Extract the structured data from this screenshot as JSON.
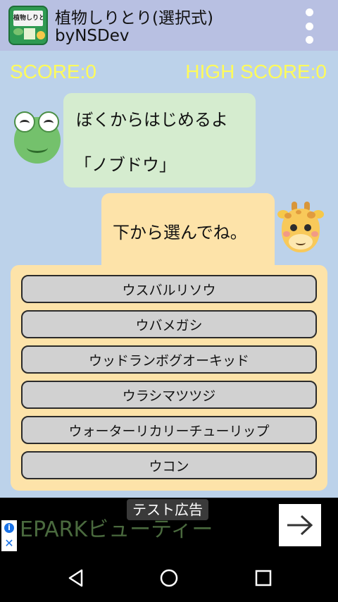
{
  "app_bar": {
    "title": "植物しりとり(選択式)",
    "subtitle": "byNSDev",
    "icon_sign_text": "植物しりとり",
    "icons": {
      "app_icon": "app-icon",
      "menu": "more-vert-icon"
    }
  },
  "scores": {
    "score": "SCORE:0",
    "high_score": "HIGH SCORE:0",
    "color": "#fffb5a"
  },
  "frog_bubble": {
    "line1": "ぼくからはじめるよ",
    "line2": "「ノブドウ」"
  },
  "giraffe_bubble": {
    "text": "下から選んでね。"
  },
  "options": [
    {
      "label": "ウスバルリソウ"
    },
    {
      "label": "ウバメガシ"
    },
    {
      "label": "ウッドランボグオーキッド"
    },
    {
      "label": "ウラシマツツジ"
    },
    {
      "label": "ウォーターリカリーチューリップ"
    },
    {
      "label": "ウコン"
    }
  ],
  "ad": {
    "test_label": "テスト広告",
    "text": "EPARKビューティー",
    "icons": {
      "info": "info-icon",
      "close": "close-icon",
      "arrow": "arrow-right-icon"
    }
  },
  "nav": {
    "icons": [
      "back-icon",
      "home-icon",
      "recent-apps-icon"
    ]
  },
  "colors": {
    "background": "#bcd2ea",
    "app_bar": "#b8c0e2",
    "frog_bubble": "#d5eccf",
    "giraffe_panel": "#fde3a9",
    "option_button": "#d1d1d1"
  }
}
